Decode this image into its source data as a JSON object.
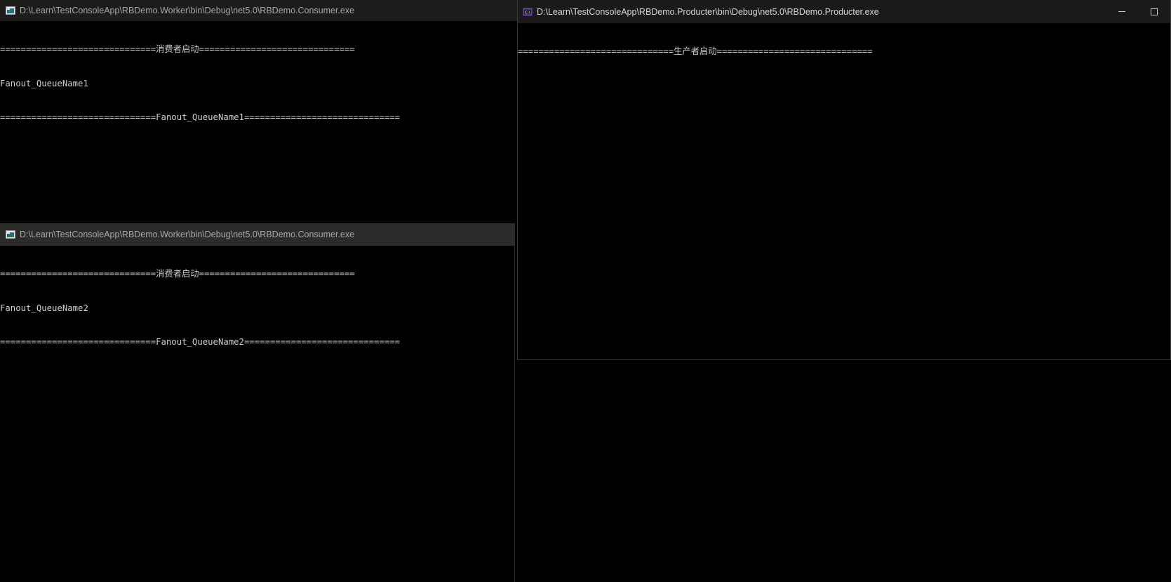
{
  "windows": {
    "consumer1": {
      "title": "D:\\Learn\\TestConsoleApp\\RBDemo.Worker\\bin\\Debug\\net5.0\\RBDemo.Consumer.exe",
      "icon": "console-app-icon",
      "lines": [
        "==============================消费者启动==============================",
        "Fanout_QueueName1",
        "==============================Fanout_QueueName1=============================="
      ]
    },
    "consumer2": {
      "title": "D:\\Learn\\TestConsoleApp\\RBDemo.Worker\\bin\\Debug\\net5.0\\RBDemo.Consumer.exe",
      "icon": "console-app-icon",
      "lines": [
        "==============================消费者启动==============================",
        "Fanout_QueueName2",
        "==============================Fanout_QueueName2=============================="
      ]
    },
    "producer": {
      "title": "D:\\Learn\\TestConsoleApp\\RBDemo.Producter\\bin\\Debug\\net5.0\\RBDemo.Producter.exe",
      "icon": "csharp-console-icon",
      "lines": [
        "==============================生产者启动=============================="
      ],
      "controls": {
        "minimize": "minimize-icon",
        "maximize": "maximize-icon"
      }
    }
  },
  "colors": {
    "console_bg": "#000000",
    "console_text": "#cfcfcf",
    "titlebar_text": "#a8a8a8",
    "producer_icon": "#6a3fa0"
  }
}
